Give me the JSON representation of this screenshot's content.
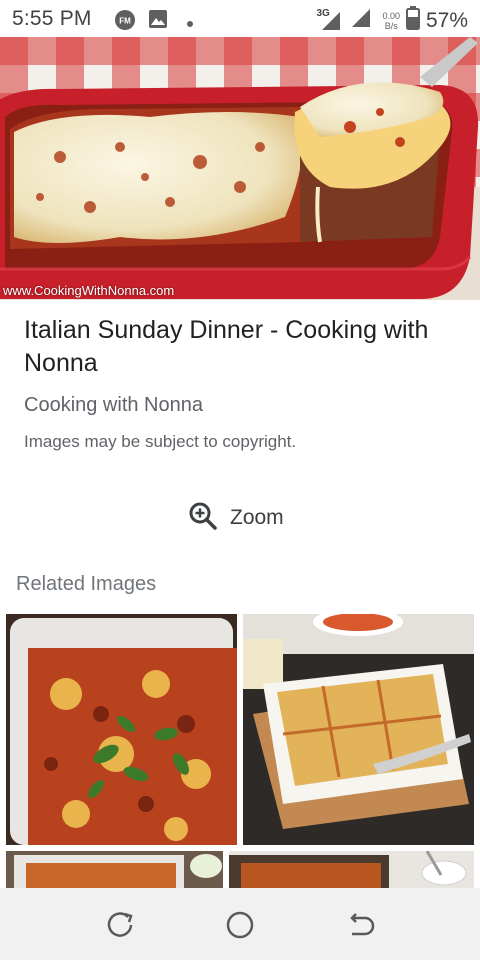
{
  "status_bar": {
    "time": "5:55 PM",
    "network_type": "3G",
    "speed_value": "0.00",
    "speed_unit": "B/s",
    "battery_percent": "57%",
    "icons": [
      "fm-radio-icon",
      "gallery-icon",
      "notification-dot-icon",
      "signal-3g-icon",
      "signal-icon",
      "battery-icon"
    ]
  },
  "hero": {
    "watermark": "www.CookingWithNonna.com"
  },
  "details": {
    "title": "Italian Sunday Dinner - Cooking with Nonna",
    "source": "Cooking with Nonna",
    "copyright_note": "Images may be subject to copyright."
  },
  "zoom": {
    "label": "Zoom",
    "icon": "zoom-in-icon"
  },
  "related": {
    "heading": "Related Images"
  },
  "nav_bar": {
    "icons": [
      "recent-apps-icon",
      "home-icon",
      "back-icon"
    ]
  },
  "colors": {
    "dish_red": "#c8202a",
    "cheese": "#f4ecd0",
    "sauce": "#a8361c",
    "text_primary": "#202124",
    "text_secondary": "#5f6368"
  }
}
